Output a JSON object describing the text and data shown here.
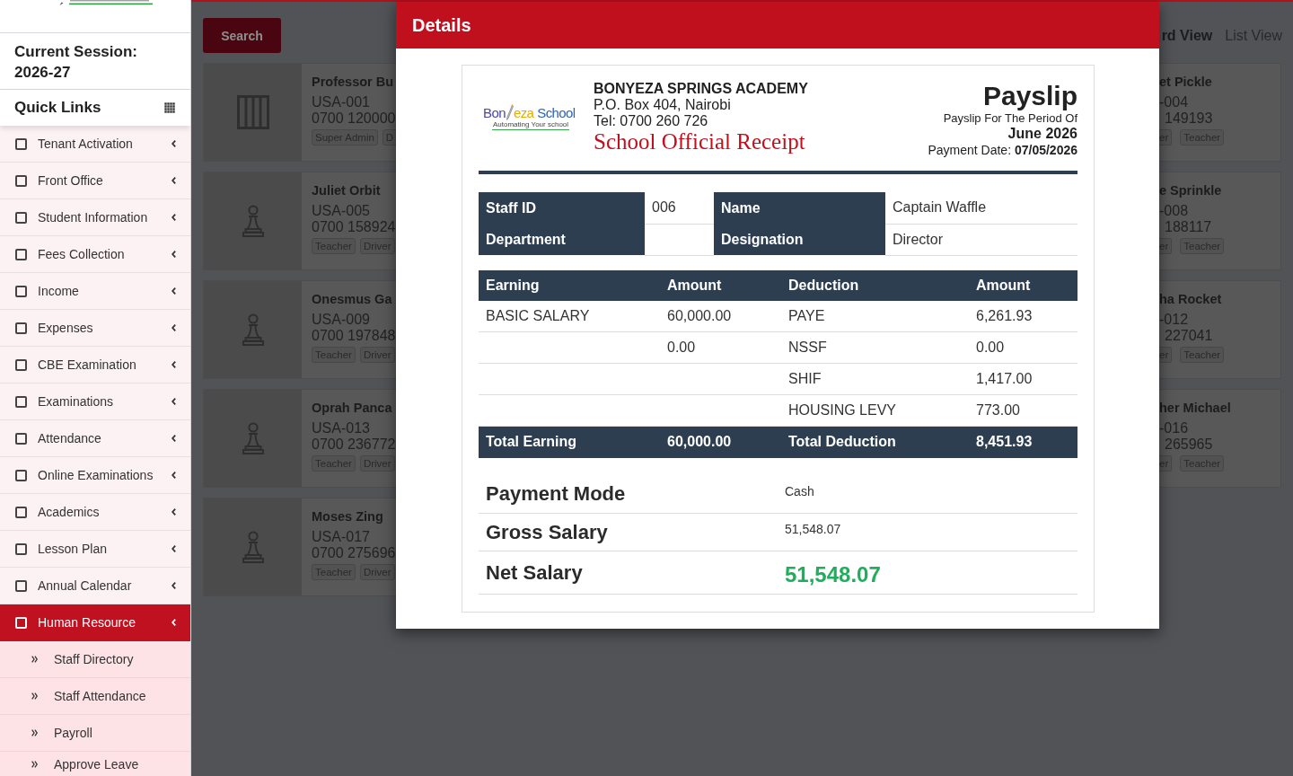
{
  "sidebar": {
    "session": "Current Session: 2026-27",
    "quick_links": "Quick Links",
    "menu": [
      {
        "label": "Tenant Activation",
        "selected": false
      },
      {
        "label": "Front Office",
        "selected": false
      },
      {
        "label": "Student Information",
        "selected": false
      },
      {
        "label": "Fees Collection",
        "selected": false
      },
      {
        "label": "Income",
        "selected": false
      },
      {
        "label": "Expenses",
        "selected": false
      },
      {
        "label": "CBE Examination",
        "selected": false
      },
      {
        "label": "Examinations",
        "selected": false
      },
      {
        "label": "Attendance",
        "selected": false
      },
      {
        "label": "Online Examinations",
        "selected": false
      },
      {
        "label": "Academics",
        "selected": false
      },
      {
        "label": "Lesson Plan",
        "selected": false
      },
      {
        "label": "Annual Calendar",
        "selected": false
      },
      {
        "label": "Human Resource",
        "selected": true,
        "children": [
          {
            "label": "Staff Directory",
            "selected": false
          },
          {
            "label": "Staff Attendance",
            "selected": false
          },
          {
            "label": "Payroll",
            "selected": false
          },
          {
            "label": "Approve Leave",
            "selected": false
          }
        ]
      }
    ]
  },
  "toolbar": {
    "search_button": "Search",
    "views": [
      {
        "label": "rd View",
        "selected": true
      },
      {
        "label": "List View",
        "selected": false
      }
    ]
  },
  "staff_cards": {
    "left_column": [
      {
        "kind": "picture",
        "name": "Professor Bu",
        "staff_no": "USA-001",
        "phone": "0700 120000",
        "tags": [
          "Super Admin",
          "D"
        ]
      },
      {
        "kind": "avatar",
        "name": "Juliet Orbit",
        "staff_no": "USA-005",
        "phone": "0700 158924",
        "tags": [
          "Teacher",
          "Driver"
        ]
      },
      {
        "kind": "avatar",
        "name": "Onesmus Ga",
        "staff_no": "USA-009",
        "phone": "0700 197848",
        "tags": [
          "Teacher",
          "Driver"
        ]
      },
      {
        "kind": "avatar",
        "name": "Oprah Panca",
        "staff_no": "USA-013",
        "phone": "0700 236772",
        "tags": [
          "Teacher",
          "Driver"
        ]
      },
      {
        "kind": "avatar",
        "name": "Moses Zing",
        "staff_no": "USA-017",
        "phone": "0700 275696",
        "tags": [
          "Teacher",
          "Driver"
        ]
      }
    ],
    "right_column": [
      {
        "name": "et Pickle",
        "staff_no": "-004",
        "phone": "149193",
        "tags": [
          "er",
          "Teacher"
        ]
      },
      {
        "name": "e Sprinkle",
        "staff_no": "-008",
        "phone": "188117",
        "tags": [
          "er",
          "Teacher"
        ]
      },
      {
        "name": "ha Rocket",
        "staff_no": "-012",
        "phone": "227041",
        "tags": [
          "er",
          "Teacher"
        ]
      },
      {
        "name": "her Michael",
        "staff_no": "-016",
        "phone": "265965",
        "tags": [
          "er",
          "Teacher"
        ]
      }
    ]
  },
  "modal": {
    "title": "Details",
    "receipt": {
      "logo": {
        "parts": [
          "Bon",
          "eza",
          "School"
        ],
        "tagline": "Automating Your school"
      },
      "school": {
        "name": "BONYEZA SPRINGS ACADEMY",
        "address": "P.O. Box 404, Nairobi",
        "phone": "Tel: 0700 260 726",
        "document_title": "School Official Receipt"
      },
      "payslip": {
        "title": "Payslip",
        "period_label": "Payslip For The Period Of",
        "period": "June 2026",
        "payment_date": "Payment Date: **07/05/2026**"
      },
      "staff_info": [
        {
          "fields": [
            {
              "label": "Staff ID",
              "value": "006"
            },
            {
              "label": "Name",
              "value": "Captain Waffle"
            }
          ]
        },
        {
          "fields": [
            {
              "label": "Department"
            },
            {
              "label": "Designation",
              "value": "Director"
            }
          ]
        }
      ],
      "pay_table": {
        "columns": [
          "Earning",
          "Amount",
          "Deduction",
          "Amount"
        ],
        "rows": [
          {
            "earning": "BASIC SALARY",
            "earning_amount": "60,000.00",
            "deduction": "PAYE",
            "deduction_amount": "6,261.93"
          },
          {
            "earning_amount": "0.00",
            "deduction": "NSSF",
            "deduction_amount": "0.00"
          },
          {
            "deduction": "SHIF",
            "deduction_amount": "1,417.00"
          },
          {
            "deduction": "HOUSING LEVY",
            "deduction_amount": "773.00"
          }
        ],
        "totals": {
          "earning": "Total Earning",
          "earning_amount": "60,000.00",
          "deduction": "Total Deduction",
          "deduction_amount": "8,451.93"
        }
      },
      "summary": [
        {
          "kind": "plain",
          "label": "Payment Mode",
          "value": "Cash"
        },
        {
          "kind": "plain",
          "label": "Gross Salary",
          "value": "51,548.07"
        },
        {
          "kind": "highlight",
          "label": "Net Salary",
          "value": "51,548.07"
        }
      ]
    }
  }
}
